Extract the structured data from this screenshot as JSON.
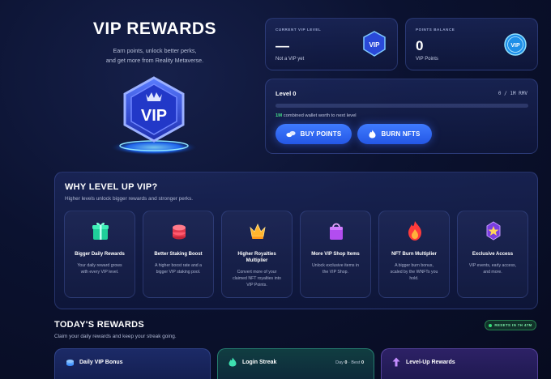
{
  "hero": {
    "title": "VIP REWARDS",
    "subtitle_line1": "Earn points, unlock better perks,",
    "subtitle_line2": "and get more from Reality Metaverse.",
    "badge_text": "VIP"
  },
  "vip_level_card": {
    "label": "CURRENT VIP LEVEL",
    "value": "—",
    "note": "Not a VIP yet",
    "badge_text": "VIP"
  },
  "points_card": {
    "label": "POINTS BALANCE",
    "value": "0",
    "note": "VIP Points",
    "badge_text": "VIP"
  },
  "level_card": {
    "title": "Level 0",
    "progress_text": "0 / 1M RMV",
    "progress_fraction": 0,
    "hint_amount": "1M",
    "hint_rest": "combined wallet worth to next level",
    "buy_label": "BUY POINTS",
    "burn_label": "BURN NFTS"
  },
  "why_section": {
    "title": "WHY LEVEL UP VIP?",
    "subtitle": "Higher levels unlock bigger rewards and stronger perks.",
    "perks": [
      {
        "title": "Bigger Daily Rewards",
        "desc1": "Your daily reward grows",
        "desc2": "with every VIP level.",
        "desc3": "",
        "icon": "gift-icon"
      },
      {
        "title": "Better Staking Boost",
        "desc1": "A higher boost rate and a",
        "desc2": "bigger VIP staking pool.",
        "desc3": "",
        "icon": "coins-icon"
      },
      {
        "title": "Higher Royalties",
        "title2": "Multiplier",
        "desc1": "Convert more of your",
        "desc2": "claimed NFT royalties into",
        "desc3": "VIP Points.",
        "icon": "crown-icon"
      },
      {
        "title": "More VIP Shop Items",
        "desc1": "Unlock exclusive items in",
        "desc2": "the VIP Shop.",
        "desc3": "",
        "icon": "shopping-bag-icon"
      },
      {
        "title": "NFT Burn Multiplier",
        "desc1": "A bigger burn bonus,",
        "desc2": "scaled by the WNFTs you",
        "desc3": "hold.",
        "icon": "flame-icon"
      },
      {
        "title": "Exclusive Access",
        "desc1": "VIP events, early access,",
        "desc2": "and more.",
        "desc3": "",
        "icon": "star-badge-icon"
      }
    ]
  },
  "today_section": {
    "title": "TODAY'S REWARDS",
    "subtitle": "Claim your daily rewards and keep your streak going.",
    "reset_text": "RESETS IN 7H 47M"
  },
  "bottom_cards": {
    "daily_title": "Daily VIP Bonus",
    "streak_title": "Login Streak",
    "streak_day_label": "Day",
    "streak_day_value": "0",
    "streak_sep": "·",
    "streak_best_label": "Best",
    "streak_best_value": "0",
    "levelup_title": "Level-Up Rewards"
  },
  "colors": {
    "accent_blue": "#3f7bff",
    "accent_green": "#35e07a",
    "background": "#0b1230"
  }
}
